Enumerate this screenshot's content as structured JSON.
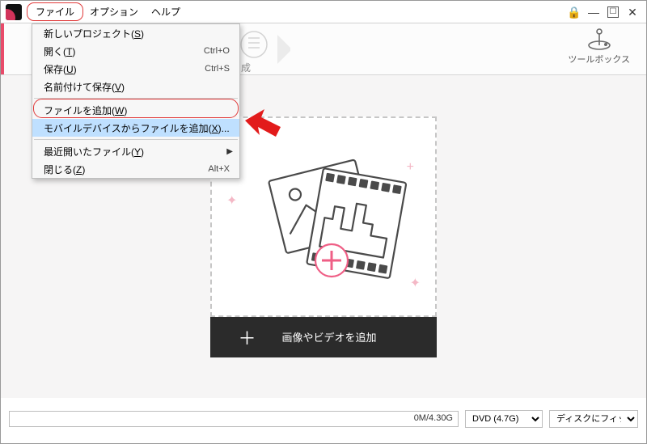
{
  "menubar": {
    "file": "ファイル",
    "options": "オプション",
    "help": "ヘルプ"
  },
  "win": {
    "lock": "🔒",
    "min": "—",
    "max": "☐",
    "close": "✕"
  },
  "toolbox_label": "ツールボックス",
  "file_menu": {
    "new_project": {
      "label": "新しいプロジェクト(",
      "hot": "S",
      "tail": ")"
    },
    "open": {
      "label": "開く(",
      "hot": "T",
      "tail": ")",
      "accel": "Ctrl+O"
    },
    "save": {
      "label": "保存(",
      "hot": "U",
      "tail": ")",
      "accel": "Ctrl+S"
    },
    "save_as": {
      "label": "名前付けて保存(",
      "hot": "V",
      "tail": ")"
    },
    "add_file": {
      "label": "ファイルを追加(",
      "hot": "W",
      "tail": ")"
    },
    "add_mobile": {
      "label": "モバイルデバイスからファイルを追加(",
      "hot": "X",
      "tail": ")..."
    },
    "recent": {
      "label": "最近開いたファイル(",
      "hot": "Y",
      "tail": ")"
    },
    "close": {
      "label": "閉じる(",
      "hot": "Z",
      "tail": ")",
      "accel": "Alt+X"
    }
  },
  "drop": {
    "button_label": "画像やビデオを追加"
  },
  "progress": {
    "label": "0M/4.30G"
  },
  "combos": {
    "disc": {
      "selected": "DVD (4.7G)"
    },
    "fit": {
      "selected": "ディスクにフィット"
    }
  },
  "steps": {
    "hidden_step_fragment": "成"
  }
}
